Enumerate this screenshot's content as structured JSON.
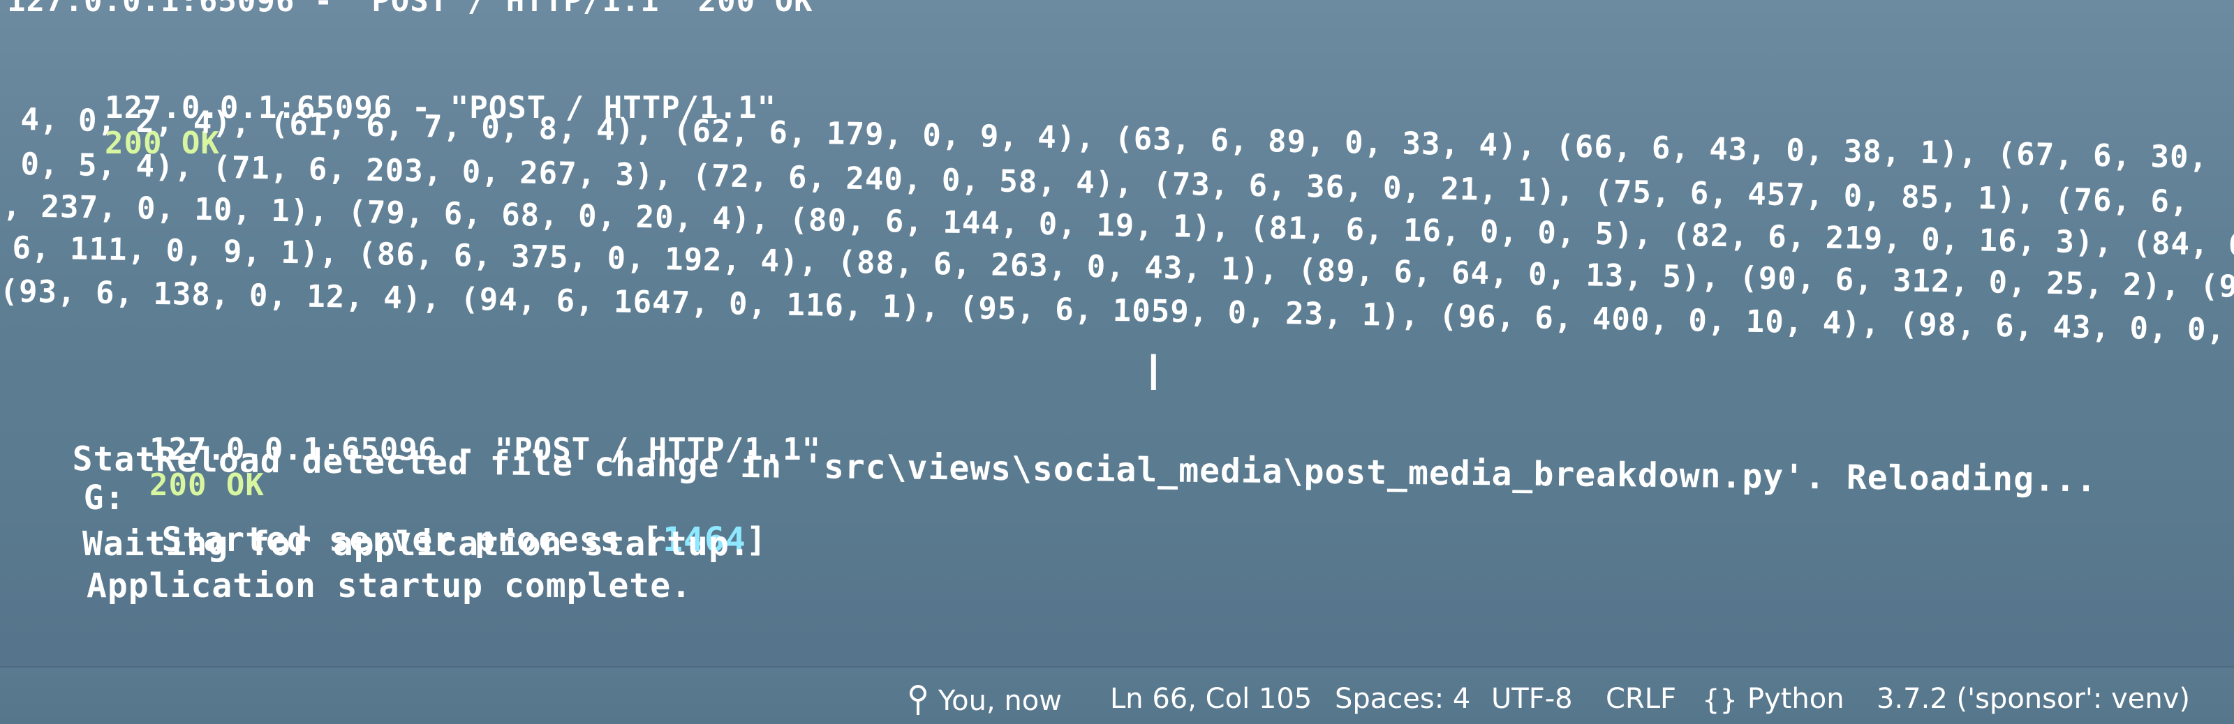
{
  "terminal": {
    "lines": [
      "127.0.0.1:65096 - \"POST / HTTP/1.1\" 200 OK",
      "127.0.0.1:65096 - \"POST / HTTP/1.1\"",
      "200 OK",
      "4, 0, 2, 4), (61, 6, 7, 0, 8, 4), (62, 6, 179, 0, 9, 4), (63, 6, 89, 0, 33, 4), (66, 6, 43, 0, 38, 1), (67, 6, 30,",
      "0, 5, 4), (71, 6, 203, 0, 267, 3), (72, 6, 240, 0, 58, 4), (73, 6, 36, 0, 21, 1), (75, 6, 457, 0, 85, 1), (76, 6,",
      ", 237, 0, 10, 1), (79, 6, 68, 0, 20, 4), (80, 6, 144, 0, 19, 1), (81, 6, 16, 0, 0, 5), (82, 6, 219, 0, 16, 3), (84, 6",
      "6, 111, 0, 9, 1), (86, 6, 375, 0, 192, 4), (88, 6, 263, 0, 43, 1), (89, 6, 64, 0, 13, 5), (90, 6, 312, 0, 25, 2), (9",
      "(93, 6, 138, 0, 12, 4), (94, 6, 1647, 0, 116, 1), (95, 6, 1059, 0, 23, 1), (96, 6, 400, 0, 10, 4), (98, 6, 43, 0, 0, 5",
      "127.0.0.1:65096 - \"POST / HTTP/1.1\"",
      "200 OK",
      "G:",
      "StatReload detected file change in 'src\\views\\social_media\\post_media_breakdown.py'. Reloading...",
      "Started server process [",
      "1464",
      "]",
      "Waiting for application startup.",
      "Application startup complete."
    ]
  },
  "statusbar": {
    "blame": "You, now",
    "position": "Ln 66, Col 105",
    "spaces": "Spaces: 4",
    "encoding": "UTF-8",
    "eol": "CRLF",
    "language_glyph": "{}",
    "language": "Python",
    "interpreter": "3.7.2 ('sponsor': venv)"
  }
}
